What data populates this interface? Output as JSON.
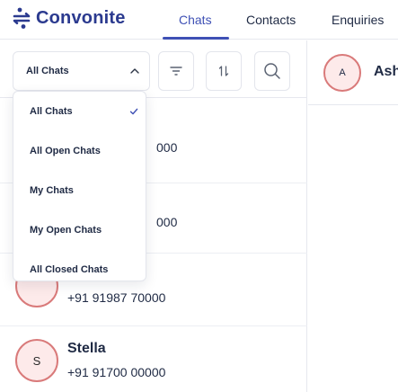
{
  "brand": {
    "name": "Convonite"
  },
  "nav": {
    "tabs": [
      {
        "label": "Chats",
        "active": true
      },
      {
        "label": "Contacts",
        "active": false
      },
      {
        "label": "Enquiries",
        "active": false
      }
    ]
  },
  "filter": {
    "selected": "All Chats",
    "options": [
      {
        "label": "All Chats",
        "checked": true
      },
      {
        "label": "All Open Chats",
        "checked": false
      },
      {
        "label": "My Chats",
        "checked": false
      },
      {
        "label": "My Open Chats",
        "checked": false
      },
      {
        "label": "All Closed Chats",
        "checked": false
      }
    ]
  },
  "toolbar": {
    "icons": [
      "filter-icon",
      "sort-icon",
      "search-icon"
    ]
  },
  "chats": {
    "partial_1": "000",
    "partial_2": "000",
    "item_3": {
      "phone": "+91 91987 70000"
    },
    "item_4": {
      "initial": "S",
      "name": "Stella",
      "phone": "+91 91700 00000"
    }
  },
  "conversation": {
    "initial": "A",
    "name": "Ash"
  },
  "colors": {
    "brand": "#2b3a8f",
    "accent": "#3f51b5",
    "avatar_border": "#d97a7a",
    "avatar_fill": "#fdeaea"
  }
}
